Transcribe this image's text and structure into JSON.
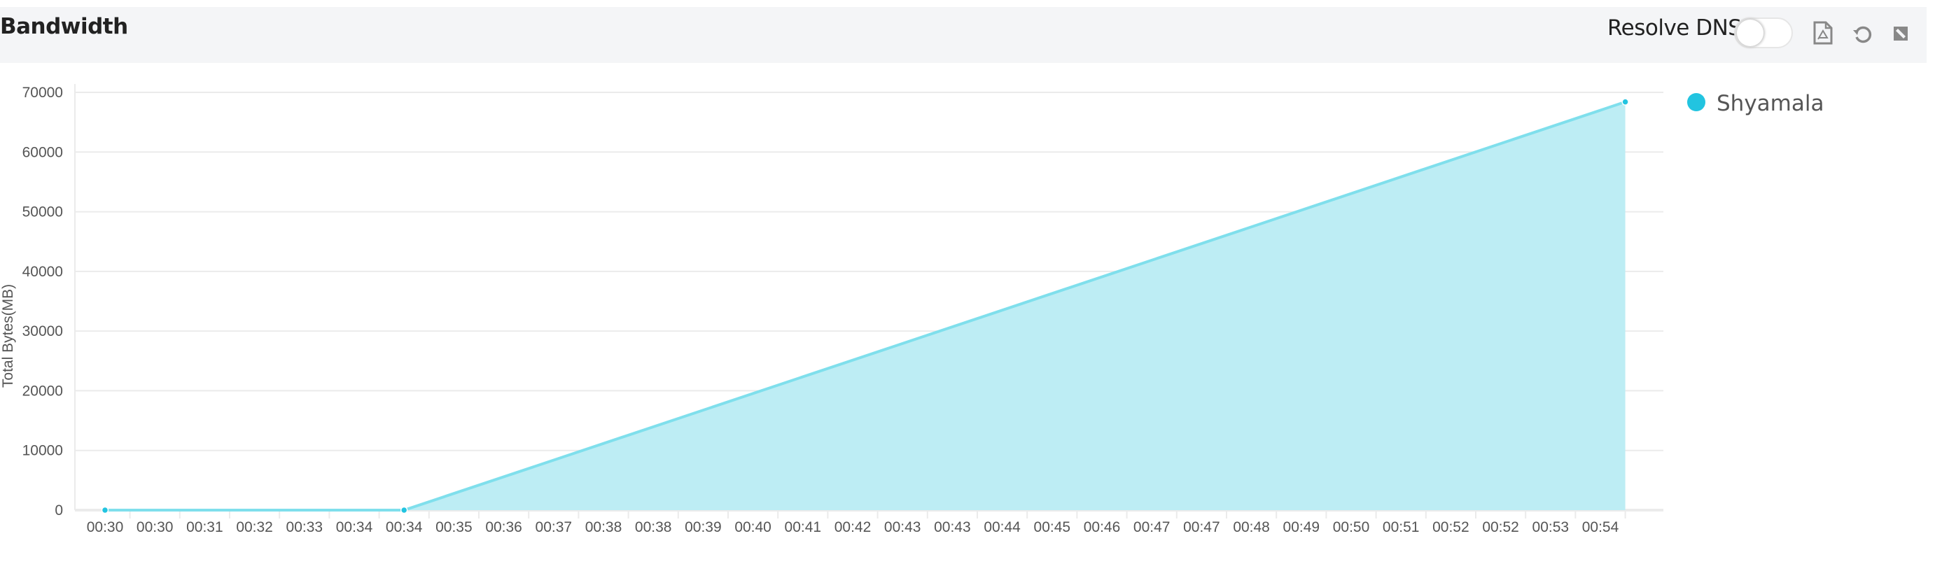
{
  "header": {
    "title": "Bandwidth",
    "resolve_dns_label": "Resolve DNS",
    "resolve_dns_on": false,
    "icons": [
      "pdf-export-icon",
      "refresh-icon",
      "collapse-icon"
    ]
  },
  "colors": {
    "series": "#22c4e0",
    "area": "#bdedf4",
    "line": "#7fdfec",
    "grid": "#ebebeb"
  },
  "chart_data": {
    "type": "area",
    "title": "Bandwidth",
    "xlabel": "",
    "ylabel": "Total Bytes(MB)",
    "ylim": [
      0,
      70000
    ],
    "yticks": [
      0,
      10000,
      20000,
      30000,
      40000,
      50000,
      60000,
      70000
    ],
    "categories": [
      "00:30",
      "00:30",
      "00:31",
      "00:32",
      "00:33",
      "00:34",
      "00:34",
      "00:35",
      "00:36",
      "00:37",
      "00:38",
      "00:38",
      "00:39",
      "00:40",
      "00:41",
      "00:42",
      "00:43",
      "00:43",
      "00:44",
      "00:45",
      "00:46",
      "00:47",
      "00:47",
      "00:48",
      "00:49",
      "00:50",
      "00:51",
      "00:52",
      "00:52",
      "00:53",
      "00:54"
    ],
    "grid": true,
    "legend_position": "top-right",
    "series": [
      {
        "name": "Shyamala",
        "points": [
          {
            "x": 0,
            "y": 0
          },
          {
            "x": 6,
            "y": 0
          },
          {
            "x": 30.5,
            "y": 68400
          }
        ]
      }
    ]
  }
}
